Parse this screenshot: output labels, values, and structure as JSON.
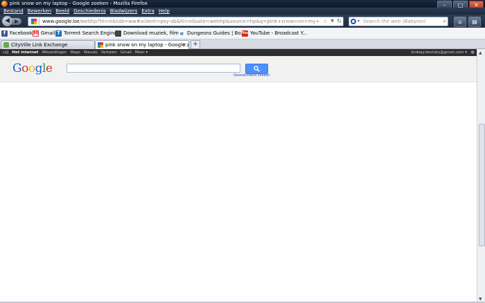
{
  "window": {
    "title": "pink snow on my laptop - Google zoeken - Mozilla Firefox"
  },
  "menu": [
    "Bestand",
    "Bewerken",
    "Beeld",
    "Geschiedenis",
    "Bladwijzers",
    "Extra",
    "Help"
  ],
  "window_buttons": {
    "minimize": "–",
    "maximize": "□",
    "close": "✕"
  },
  "nav": {
    "back": "◀",
    "forward": "▶",
    "url_domain": "www.google.be",
    "url_rest": "/webhp?hl=nl&tab=ww#sclient=psy-ab&hl=nl&site=webhp&source=hp&q=pink+snow+on+my+laptop&pbx=",
    "search_placeholder": "Search the web (Babylon)"
  },
  "bookmarks": [
    {
      "label": "Facebook",
      "icon": "facebook-icon"
    },
    {
      "label": "Gmail",
      "icon": "gmail-icon"
    },
    {
      "label": "Torrent Search Engine",
      "icon": "torrent-icon"
    },
    {
      "label": "Download muziek, film...",
      "icon": "printer-icon"
    },
    {
      "label": "Dungeons Guides | Bo...",
      "icon": "ie-icon"
    },
    {
      "label": "YouTube - Broadcast Y...",
      "icon": "youtube-icon"
    }
  ],
  "tabs": [
    {
      "label": "CityVille Link Exchange",
      "active": false
    },
    {
      "label": "pink snow on my laptop - Google zoe...",
      "active": true
    }
  ],
  "new_tab": "+",
  "gbar": {
    "items": [
      "+Jij",
      "Het internet",
      "Afbeeldingen",
      "Maps",
      "Nieuws",
      "Vertalen",
      "Gmail",
      "Meer ▾"
    ],
    "active_index": 1,
    "user": "lindsay.destoky@gmail.com ▾"
  },
  "google": {
    "logo_letters": [
      "G",
      "o",
      "o",
      "g",
      "l",
      "e"
    ],
    "query": "",
    "advanced_link": "Geavanceerd zoeken",
    "accent": "#4d90fe"
  }
}
